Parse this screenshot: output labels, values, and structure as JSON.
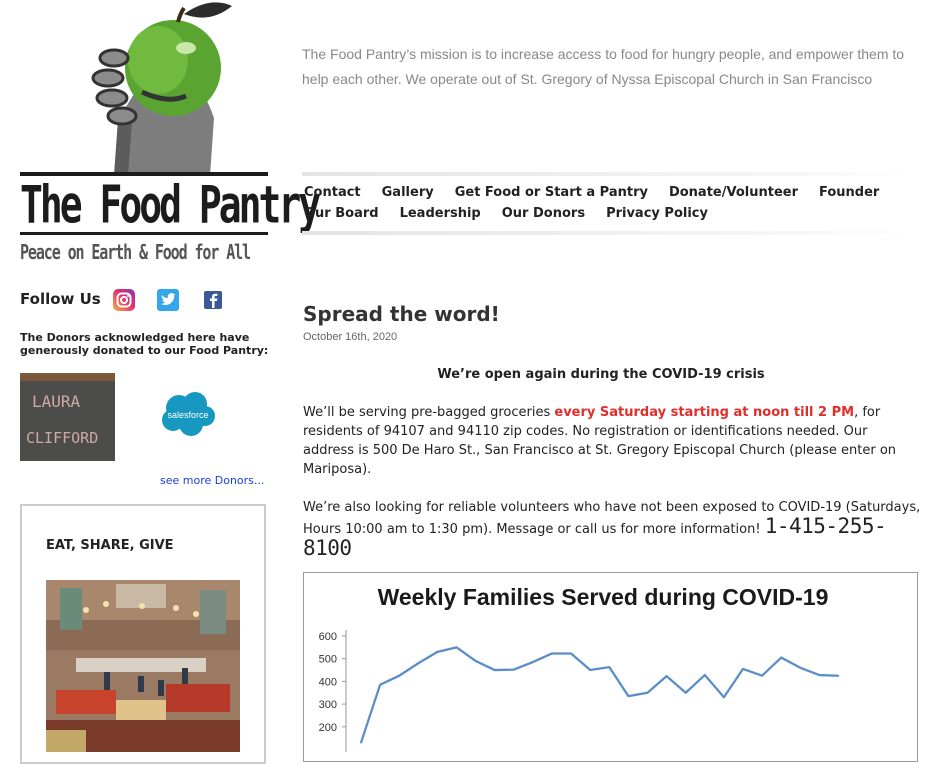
{
  "site": {
    "logo_title": "The Food Pantry",
    "logo_tagline": "Peace on Earth & Food for All",
    "mission": "The Food Pantry’s mission is to increase access to food for hungry people, and empower them to help each other. We operate out of St. Gregory of Nyssa Episcopal Church in San Francisco"
  },
  "nav": {
    "items": [
      "Contact",
      "Gallery",
      "Get Food or Start a Pantry",
      "Donate/Volunteer",
      "Founder",
      "Our Board",
      "Leadership",
      "Our Donors",
      "Privacy Policy"
    ]
  },
  "sidebar": {
    "follow_label": "Follow Us",
    "social_icons": [
      "instagram-icon",
      "twitter-icon",
      "facebook-icon"
    ],
    "donors_text": "The Donors acknowledged here have generously donated to our Food Pantry:",
    "chalk_text_line1": "LAURA",
    "chalk_text_line2": "CLIFFORD",
    "salesforce_label": "salesforce",
    "see_more": "see more Donors...",
    "box_title": "EAT, SHARE, GIVE"
  },
  "post": {
    "title": "Spread the word!",
    "date": "October 16th, 2020",
    "headline": "We’re open again during the COVID-19 crisis",
    "p1_before": "We’ll be serving pre-bagged groceries ",
    "p1_highlight": "every Saturday starting at noon till 2 PM",
    "p1_after": ", for residents of 94107 and 94110 zip codes.  No registration or identifications needed.  Our address is 500 De Haro St., San Francisco at St. Gregory Episcopal Church (please enter on Mariposa).",
    "p2": "We’re also looking for reliable volunteers who have not been exposed to COVID-19 (Saturdays, Hours 10:00 am to 1:30 pm). Message or call us for more information!",
    "phone": "1-415-255-8100"
  },
  "colors": {
    "highlight": "#e12e2a",
    "link": "#1a3fd8",
    "line": "#5b8ec7"
  },
  "chart_data": {
    "type": "line",
    "title": "Weekly Families Served during COVID-19",
    "xlabel": "",
    "ylabel": "",
    "yticks": [
      600,
      500,
      400,
      300,
      200
    ],
    "series": [
      {
        "values": [
          130,
          385,
          425,
          480,
          530,
          550,
          490,
          450,
          452,
          485,
          523,
          523,
          450,
          463,
          335,
          350,
          423,
          350,
          428,
          330,
          455,
          425,
          505,
          460,
          428,
          425
        ]
      }
    ],
    "grid": false
  }
}
